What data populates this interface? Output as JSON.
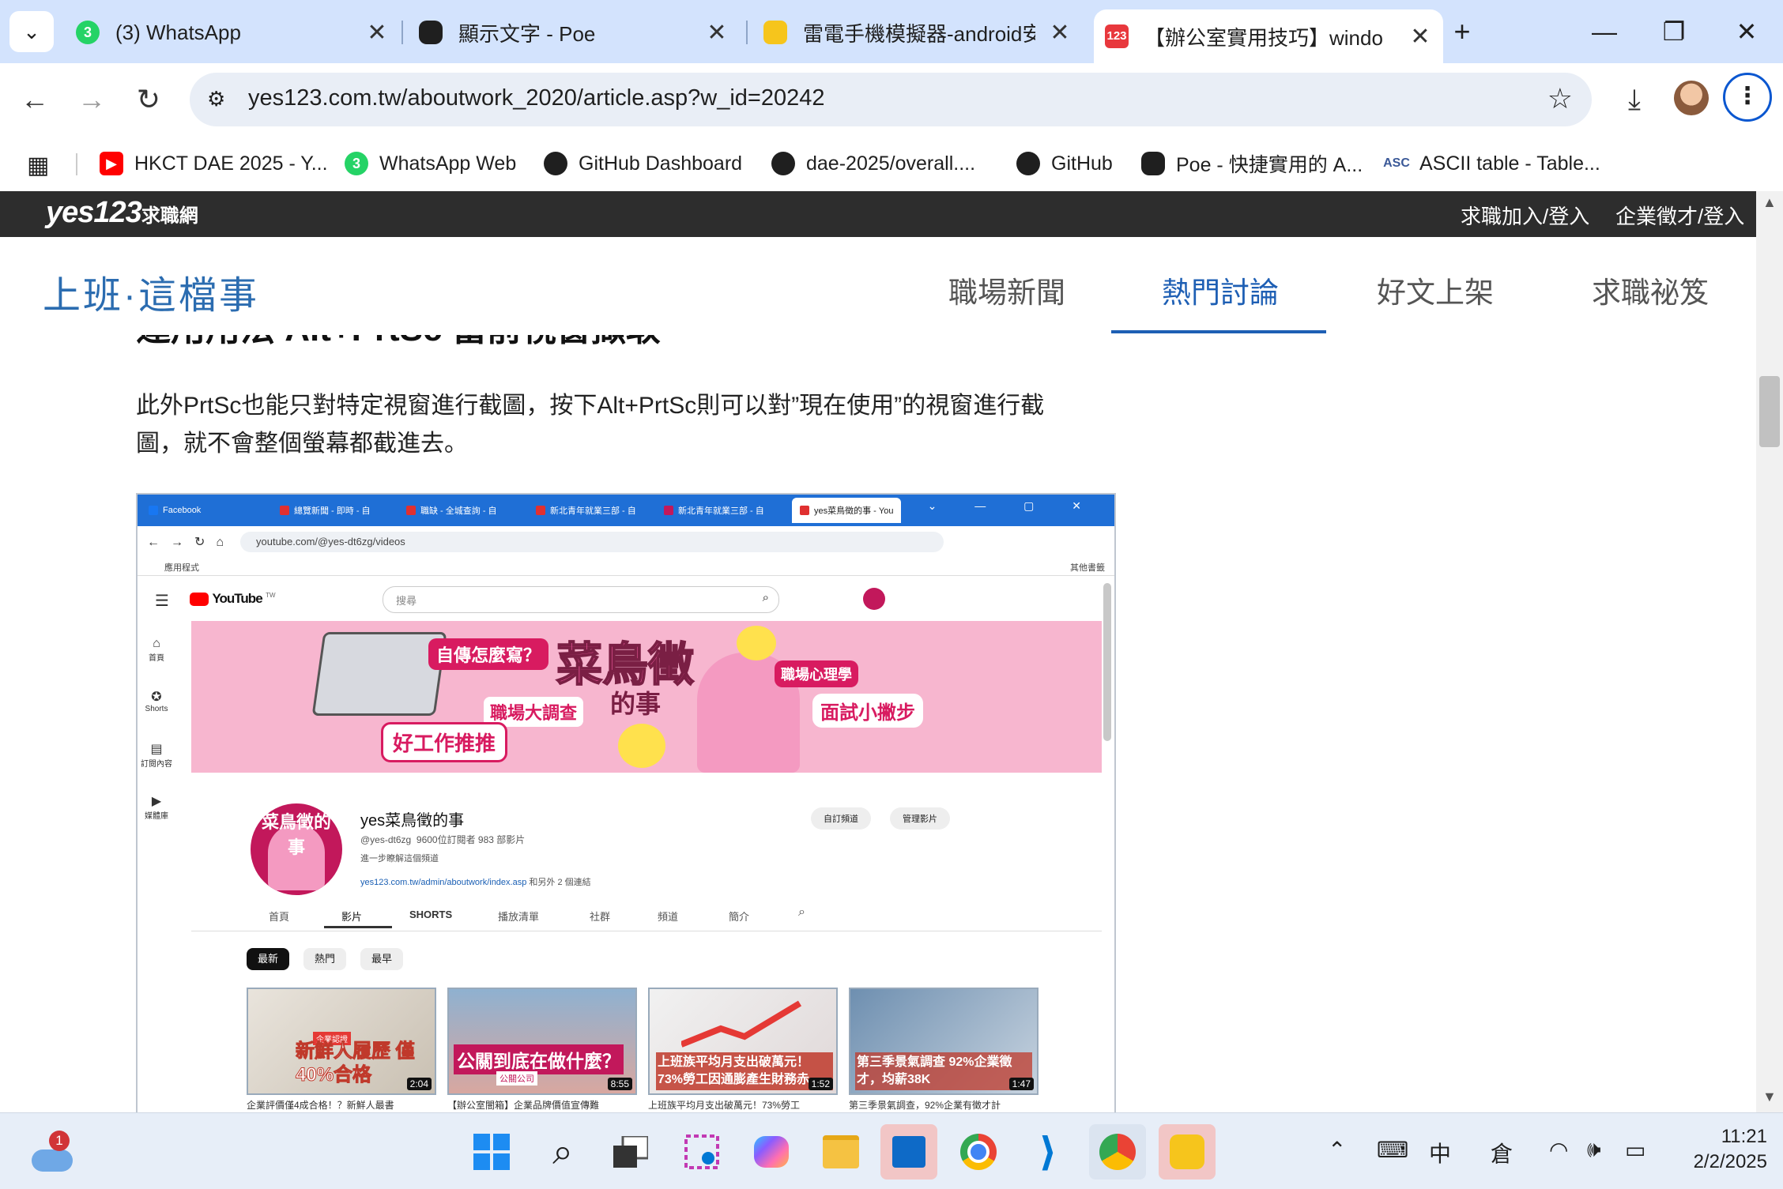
{
  "browser": {
    "tabs": [
      {
        "title": "(3) WhatsApp",
        "icon": "whatsapp-icon",
        "active": false
      },
      {
        "title": "顯示文字 - Poe",
        "icon": "poe-icon",
        "active": false
      },
      {
        "title": "雷電手機模擬器-android安",
        "icon": "ldplayer-icon",
        "active": false
      },
      {
        "title": "【辦公室實用技巧】windo",
        "icon": "yes123-icon",
        "active": true
      }
    ],
    "new_tab": "+",
    "url": "yes123.com.tw/aboutwork_2020/article.asp?w_id=20242",
    "bookmarks": [
      {
        "label": "HKCT DAE 2025 - Y...",
        "icon": "youtube-icon",
        "color": "#ff0000"
      },
      {
        "label": "WhatsApp Web",
        "icon": "whatsapp-icon",
        "color": "#25d366"
      },
      {
        "label": "GitHub Dashboard",
        "icon": "github-icon",
        "color": "#1f1f1f"
      },
      {
        "label": "dae-2025/overall....",
        "icon": "github-icon",
        "color": "#1f1f1f"
      },
      {
        "label": "GitHub",
        "icon": "github-icon",
        "color": "#1f1f1f"
      },
      {
        "label": "Poe - 快捷實用的 A...",
        "icon": "poe-icon",
        "color": "#5d5cde"
      },
      {
        "label": "ASCII table - Table...",
        "icon": "ascii-icon",
        "color": "#3b5998"
      }
    ]
  },
  "site": {
    "logo_main": "yes123",
    "logo_sub": "求職網",
    "top_links": [
      "求職加入/登入",
      "企業徵才/登入"
    ],
    "brand": "上班·這檔事",
    "nav": [
      "職場新聞",
      "熱門討論",
      "好文上架",
      "求職祕笈"
    ],
    "active_nav": "熱門討論",
    "heading_partial": "運用用法 Alt+PrtSc 當前視窗擷取",
    "paragraph": "此外PrtSc也能只對特定視窗進行截圖，按下Alt+PrtSc則可以對”現在使用”的視窗進行截圖，就不會整個螢幕都截進去。",
    "paragraph_line1": "此外PrtSc也能只對特定視窗進行截圖，按下Alt+PrtSc則可以對”現在使用”的視窗進行截",
    "paragraph_line2": "圖，就不會整個螢幕都截進去。"
  },
  "screenshot": {
    "tabs": [
      "Facebook",
      "總覽新聞 - 即時 - 自",
      "職缺 - 全城查詢 - 自",
      "新北青年就業三部 - 自",
      "新北青年就業三部 - 自",
      "yes菜鳥徵的事 - You"
    ],
    "url": "youtube.com/@yes-dt6zg/videos",
    "bookmark_label": "應用程式",
    "other_bookmarks": "其他書籤",
    "search_placeholder": "搜尋",
    "youtube_logo": "YouTube",
    "youtube_region": "TW",
    "sidebar": [
      "首頁",
      "Shorts",
      "訂閱內容",
      "媒體庫"
    ],
    "banner_texts": [
      "自傳怎麼寫？",
      "菜鳥徵",
      "的事",
      "職場心理學",
      "面試小撇步",
      "職場大調查",
      "好工作推推"
    ],
    "avatar_text": "菜鳥徵的事",
    "channel_name": "yes菜鳥徵的事",
    "channel_handle": "@yes-dt6zg",
    "channel_stats": "9600位訂閱者  983 部影片",
    "channel_more": "進一步瞭解這個頻道",
    "channel_link": "yes123.com.tw/admin/aboutwork/index.asp",
    "channel_link_more": "和另外 2 個連結",
    "btn_customize": "自訂頻道",
    "btn_manage": "管理影片",
    "channel_tabs": [
      "首頁",
      "影片",
      "SHORTS",
      "播放清單",
      "社群",
      "頻道",
      "簡介"
    ],
    "chips": [
      "最新",
      "熱門",
      "最早"
    ],
    "videos": [
      {
        "title_overlay": "新鮮人履歷 僅40%合格",
        "badge": "企業認證",
        "duration": "2:04",
        "caption": "企業評價僅4成合格！？新鮮人最書"
      },
      {
        "title_overlay": "公關到底在做什麼？",
        "badge": "公關公司",
        "duration": "8:55",
        "caption": "【辦公室闇箱】企業品牌價值宣傳難"
      },
      {
        "title_overlay": "上班族平均月支出破萬元！ 73%勞工因通膨產生財務赤",
        "badge": "",
        "duration": "1:52",
        "caption": "上班族平均月支出破萬元！73%勞工"
      },
      {
        "title_overlay": "第三季景氣調查 92%企業徵才，均薪38K",
        "badge": "",
        "duration": "1:47",
        "caption": "第三季景氣調查，92%企業有徵才計"
      }
    ]
  },
  "taskbar": {
    "weather_badge": "1",
    "ime": [
      "中",
      "倉"
    ],
    "time": "11:21",
    "date": "2/2/2025"
  },
  "colors": {
    "tabstrip": "#d3e3fd",
    "brand_blue": "#2b6cb0",
    "active_nav": "#1e5fb4",
    "banner_pink": "#f7b6cf",
    "sitebar": "#2d2d2d"
  }
}
